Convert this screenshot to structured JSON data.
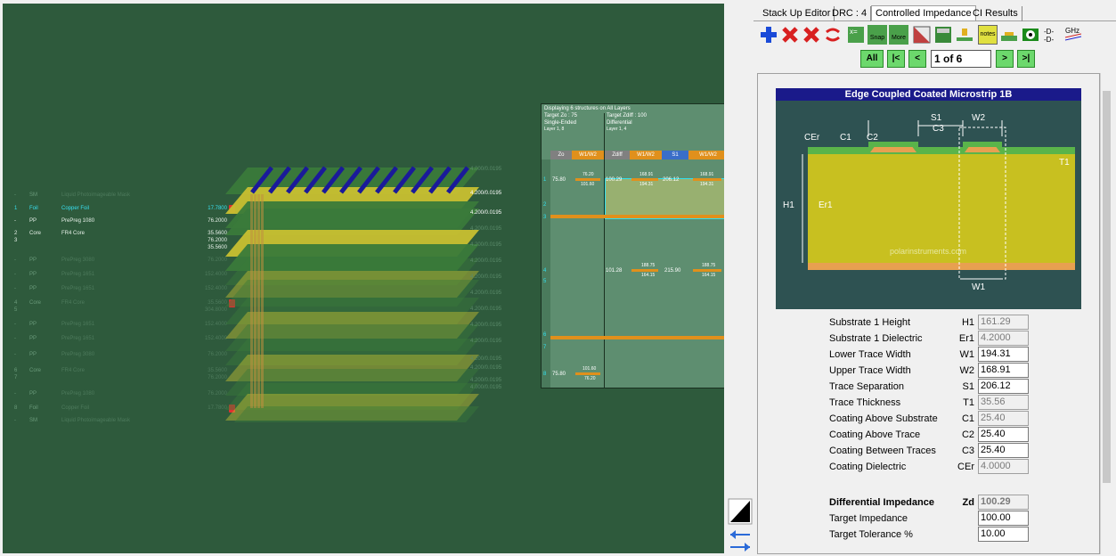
{
  "tabs": [
    {
      "label": "Stack Up Editor"
    },
    {
      "label": "DRC : 4"
    },
    {
      "label": "Controlled Impedance"
    },
    {
      "label": "CI Results"
    }
  ],
  "toolbar": {
    "icons": [
      "add-icon",
      "delete-icon",
      "delete-all-icon",
      "swap-icon",
      "calculate-icon",
      "snap-icon",
      "more-icon",
      "hatch-icon",
      "table-icon",
      "layer-icon",
      "notes-icon",
      "trace-icon",
      "view-icon",
      "diff-icon",
      "ghz-icon"
    ],
    "snap_label": "Snap",
    "more_label": "More",
    "notes_label": "notes",
    "ghz_label": "GHz"
  },
  "nav": {
    "all": "All",
    "first": "|<",
    "prev": "<",
    "position": "1 of 6",
    "next": ">",
    "last": ">|"
  },
  "stack_layers": [
    {
      "num": "-",
      "type": "SM",
      "material": "Liquid Photoimageable Mask",
      "thickness": "",
      "state": "dim"
    },
    {
      "num": "1",
      "type": "Foil",
      "material": "Copper Foil",
      "thickness": "17.7800",
      "state": "copper",
      "warn": true
    },
    {
      "num": "-",
      "type": "PP",
      "material": "PrePreg 1080",
      "thickness": "76.2000",
      "state": "active"
    },
    {
      "num": "2",
      "type": "Core",
      "material": "FR4 Core",
      "thickness": "35.5600",
      "state": "active"
    },
    {
      "num": "3",
      "type": "",
      "material": "",
      "thickness": "76.2000",
      "state": "active"
    },
    {
      "num": "",
      "type": "",
      "material": "",
      "thickness": "35.5600",
      "state": "active"
    },
    {
      "num": "-",
      "type": "PP",
      "material": "PrePreg 3080",
      "thickness": "76.2000",
      "state": "dim"
    },
    {
      "num": "-",
      "type": "PP",
      "material": "PrePreg 1651",
      "thickness": "152.4000",
      "state": "dim"
    },
    {
      "num": "-",
      "type": "PP",
      "material": "PrePreg 1651",
      "thickness": "152.4000",
      "state": "dim"
    },
    {
      "num": "4",
      "type": "Core",
      "material": "FR4 Core",
      "thickness": "35.5600",
      "state": "dim",
      "warn": true
    },
    {
      "num": "5",
      "type": "",
      "material": "",
      "thickness": "304.8000",
      "state": "dim"
    },
    {
      "num": "-",
      "type": "PP",
      "material": "PrePreg 1651",
      "thickness": "152.4000",
      "state": "dim"
    },
    {
      "num": "-",
      "type": "PP",
      "material": "PrePreg 1651",
      "thickness": "152.4000",
      "state": "dim"
    },
    {
      "num": "-",
      "type": "PP",
      "material": "PrePreg 3080",
      "thickness": "76.2000",
      "state": "dim"
    },
    {
      "num": "6",
      "type": "Core",
      "material": "FR4 Core",
      "thickness": "35.5600",
      "state": "dim"
    },
    {
      "num": "7",
      "type": "",
      "material": "",
      "thickness": "76.2000",
      "state": "dim"
    },
    {
      "num": "-",
      "type": "PP",
      "material": "PrePreg 1080",
      "thickness": "76.2000",
      "state": "dim"
    },
    {
      "num": "8",
      "type": "Foil",
      "material": "Copper Foil",
      "thickness": "17.7800",
      "state": "dim",
      "warn": true
    },
    {
      "num": "-",
      "type": "SM",
      "material": "Liquid Photoimageable Mask",
      "thickness": "",
      "state": "dim"
    }
  ],
  "view_labels": [
    "4.000/0.0195",
    "4.200/0.0195",
    "4.200/0.0195",
    "4.200/0.0195",
    "4.200/0.0195",
    "4.200/0.0195",
    "4.200/0.0195",
    "4.200/0.0195",
    "4.200/0.0195",
    "4.200/0.0195",
    "4.200/0.0195",
    "4.200/0.0195",
    "4.200/0.0195",
    "4.200/0.0195",
    "4.000/0.0195"
  ],
  "summary": {
    "caption": "Displaying 6 structures on All Layers",
    "target_zo": "Target Zo : 75",
    "single_ended": "Single-Ended",
    "layer_se": "Layer 1, 8",
    "target_zdiff": "Target Zdiff : 100",
    "differential": "Differential",
    "layer_diff": "Layer 1, 4",
    "headers": [
      "Zo",
      "W1/W2",
      "Zdiff",
      "W1/W2",
      "S1",
      "W1/W2"
    ],
    "rows": [
      {
        "zo": "75.80",
        "w_se_top": "76.20",
        "w_se_bot": "101.60",
        "zdiff": "100.29",
        "w_a_top": "168.91",
        "w_a_bot": "194.31",
        "s1": "206.12",
        "w_b_top": "168.91",
        "w_b_bot": "194.31"
      },
      {
        "zo": "",
        "zdiff": "101.28",
        "w_a_top": "188.75",
        "w_a_bot": "164.15",
        "s1": "215.90",
        "w_b_top": "188.75",
        "w_b_bot": "164.15"
      },
      {
        "zo": "75.80",
        "w_se_top": "101.60",
        "w_se_bot": "76.20"
      }
    ],
    "row_nums": [
      "1",
      "2",
      "3",
      "4",
      "5",
      "6",
      "7",
      "8"
    ]
  },
  "diagram": {
    "title": "Edge Coupled Coated Microstrip 1B",
    "labels": {
      "cer": "CEr",
      "c1": "C1",
      "c2": "C2",
      "c3": "C3",
      "s1": "S1",
      "w2": "W2",
      "t1": "T1",
      "h1": "H1",
      "er1": "Er1",
      "w1": "W1"
    },
    "watermark": "polarinstruments.com"
  },
  "params": [
    {
      "label": "Substrate 1 Height",
      "symbol": "H1",
      "value": "161.29",
      "readonly": true
    },
    {
      "label": "Substrate 1 Dielectric",
      "symbol": "Er1",
      "value": "4.2000",
      "readonly": true
    },
    {
      "label": "Lower Trace Width",
      "symbol": "W1",
      "value": "194.31",
      "readonly": false
    },
    {
      "label": "Upper Trace Width",
      "symbol": "W2",
      "value": "168.91",
      "readonly": false
    },
    {
      "label": "Trace Separation",
      "symbol": "S1",
      "value": "206.12",
      "readonly": false
    },
    {
      "label": "Trace Thickness",
      "symbol": "T1",
      "value": "35.56",
      "readonly": true
    },
    {
      "label": "Coating Above Substrate",
      "symbol": "C1",
      "value": "25.40",
      "readonly": true
    },
    {
      "label": "Coating Above Trace",
      "symbol": "C2",
      "value": "25.40",
      "readonly": false
    },
    {
      "label": "Coating Between Traces",
      "symbol": "C3",
      "value": "25.40",
      "readonly": false
    },
    {
      "label": "Coating Dielectric",
      "symbol": "CEr",
      "value": "4.0000",
      "readonly": true
    }
  ],
  "results": [
    {
      "label": "Differential Impedance",
      "symbol": "Zd",
      "value": "100.29",
      "readonly": true,
      "bold": true
    },
    {
      "label": "Target Impedance",
      "symbol": "",
      "value": "100.00",
      "readonly": false,
      "bold": false
    },
    {
      "label": "Target Tolerance %",
      "symbol": "",
      "value": "10.00",
      "readonly": false,
      "bold": false
    }
  ],
  "colors": {
    "board": "#2e5a3c",
    "copper": "#e0901c",
    "trace": "#1a1a9a",
    "core": "#d8d838",
    "title_bar": "#1a1a8a"
  }
}
